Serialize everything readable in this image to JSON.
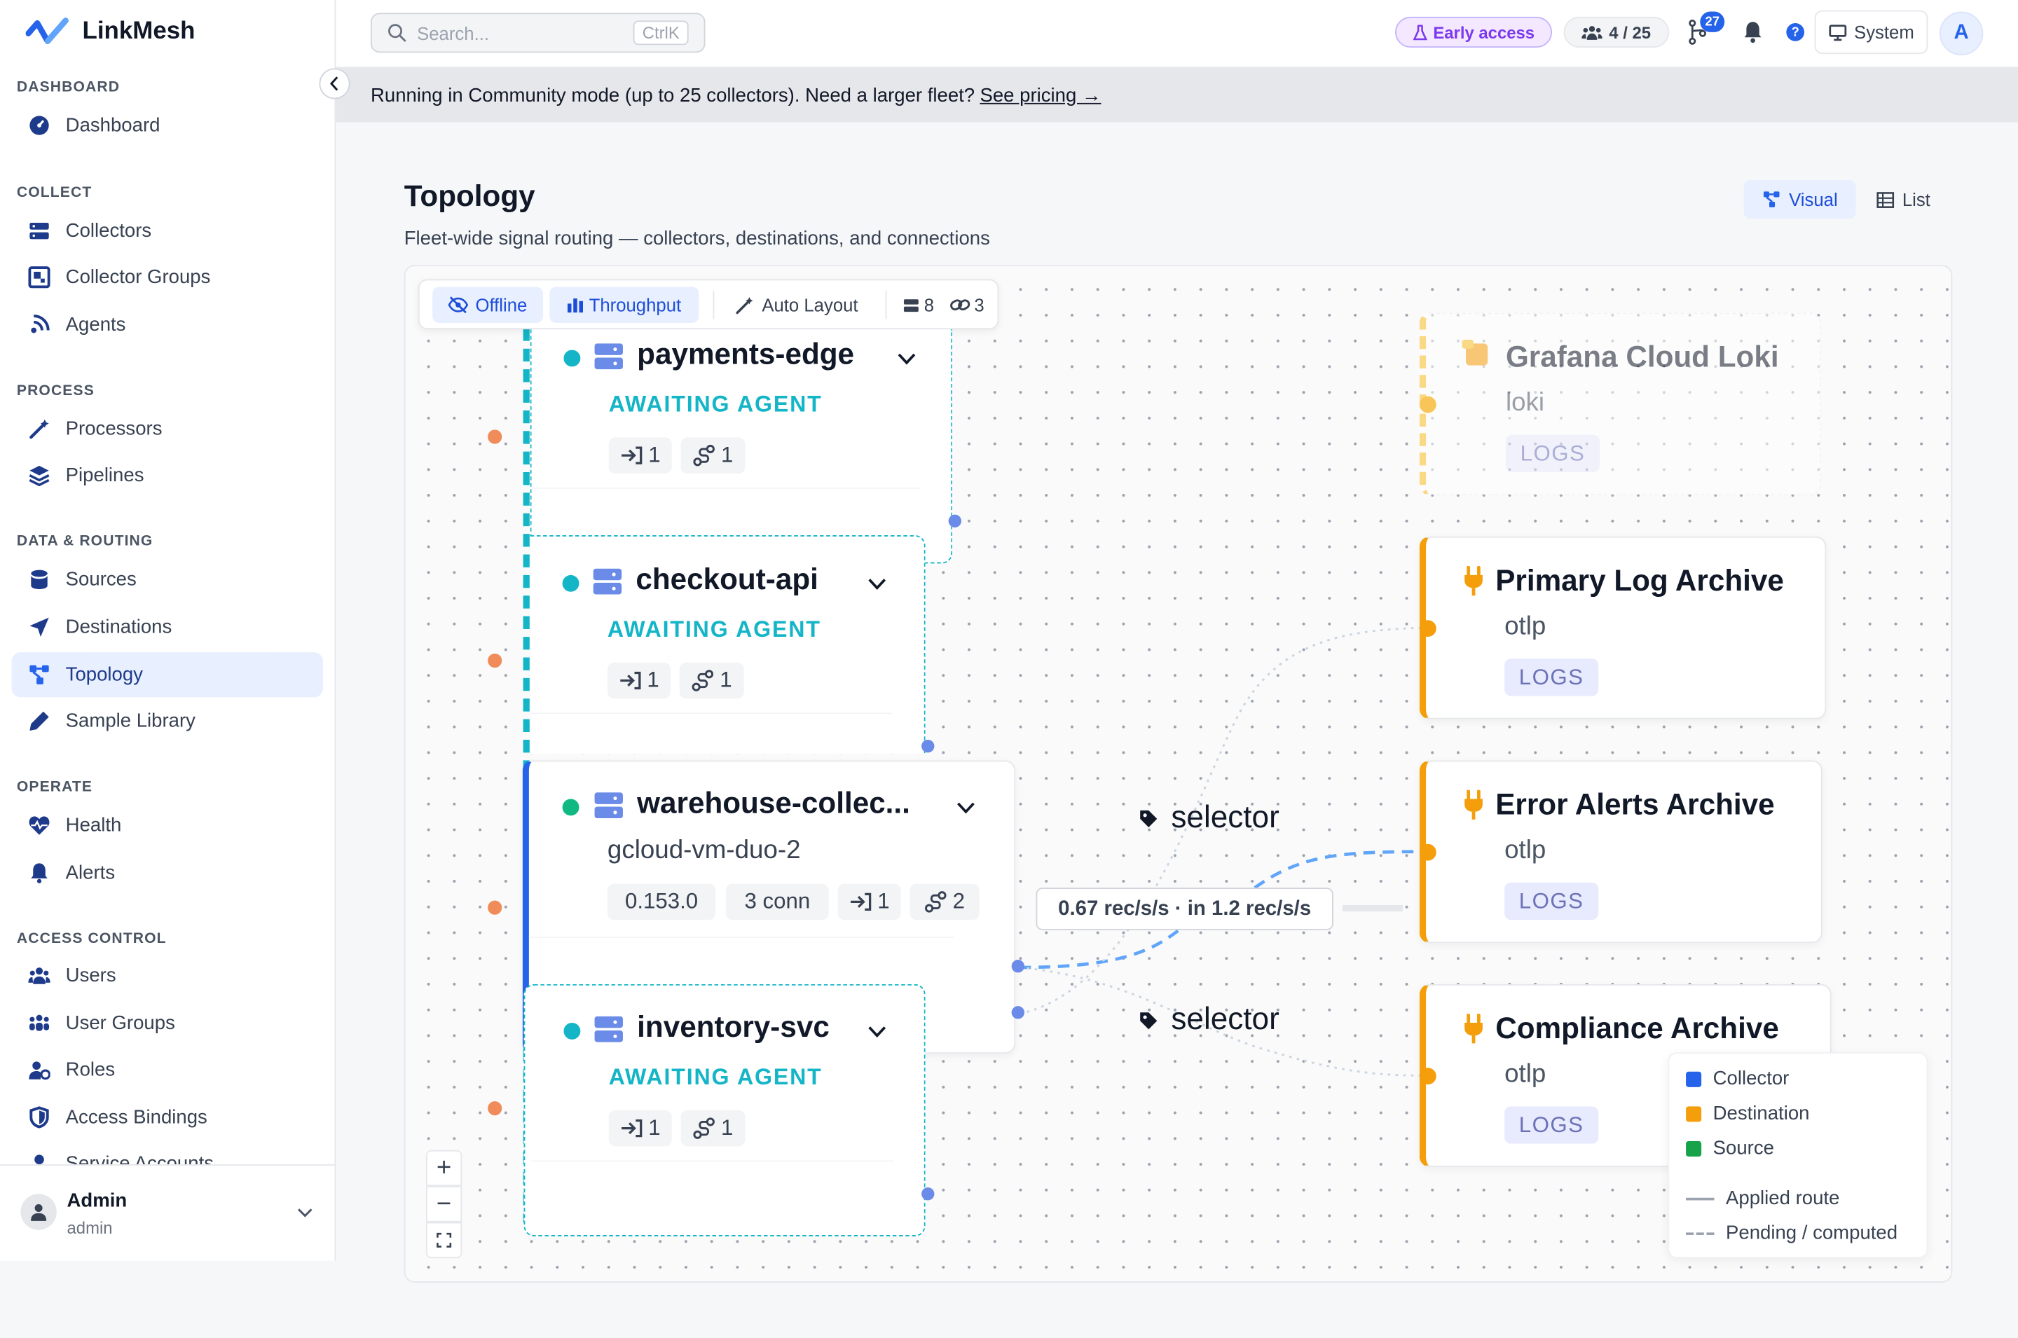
{
  "app": {
    "name": "LinkMesh"
  },
  "sidebar": {
    "sections": [
      {
        "title": "DASHBOARD",
        "items": [
          {
            "label": "Dashboard",
            "icon": "dashboard-icon"
          }
        ]
      },
      {
        "title": "COLLECT",
        "items": [
          {
            "label": "Collectors",
            "icon": "server-icon"
          },
          {
            "label": "Collector Groups",
            "icon": "group-icon"
          },
          {
            "label": "Agents",
            "icon": "signal-icon"
          }
        ]
      },
      {
        "title": "PROCESS",
        "items": [
          {
            "label": "Processors",
            "icon": "wand-icon"
          },
          {
            "label": "Pipelines",
            "icon": "layers-icon"
          }
        ]
      },
      {
        "title": "DATA & ROUTING",
        "items": [
          {
            "label": "Sources",
            "icon": "database-icon"
          },
          {
            "label": "Destinations",
            "icon": "send-icon"
          },
          {
            "label": "Topology",
            "icon": "topology-icon",
            "active": true
          },
          {
            "label": "Sample Library",
            "icon": "pen-icon"
          }
        ]
      },
      {
        "title": "OPERATE",
        "items": [
          {
            "label": "Health",
            "icon": "heartbeat-icon"
          },
          {
            "label": "Alerts",
            "icon": "bell-icon"
          }
        ]
      },
      {
        "title": "ACCESS CONTROL",
        "items": [
          {
            "label": "Users",
            "icon": "users-icon"
          },
          {
            "label": "User Groups",
            "icon": "user-groups-icon"
          },
          {
            "label": "Roles",
            "icon": "role-icon"
          },
          {
            "label": "Access Bindings",
            "icon": "shield-icon"
          },
          {
            "label": "Service Accounts",
            "icon": "key-icon"
          }
        ]
      }
    ],
    "user": {
      "name": "Admin",
      "role": "admin"
    }
  },
  "header": {
    "search_placeholder": "Search...",
    "search_shortcut": "CtrlK",
    "early_access": "Early access",
    "collector_count": "4 / 25",
    "pr_badge": "27",
    "theme": "System",
    "avatar": "A"
  },
  "banner": {
    "text": "Running in Community mode (up to 25 collectors). Need a larger fleet?",
    "link": "See pricing →"
  },
  "page": {
    "title": "Topology",
    "subtitle": "Fleet-wide signal routing — collectors, destinations, and connections",
    "view_visual": "Visual",
    "view_list": "List"
  },
  "toolbar": {
    "offline": "Offline",
    "throughput": "Throughput",
    "auto_layout": "Auto Layout",
    "node_count": "8",
    "link_count": "3"
  },
  "collectors": [
    {
      "name": "payments-edge",
      "status": "AWAITING AGENT",
      "inputs": "1",
      "routes": "1",
      "status_color": "#13b5c7"
    },
    {
      "name": "checkout-api",
      "status": "AWAITING AGENT",
      "inputs": "1",
      "routes": "1",
      "status_color": "#13b5c7"
    },
    {
      "name": "warehouse-collec...",
      "host": "gcloud-vm-duo-2",
      "version": "0.153.0",
      "conns": "3 conn",
      "inputs": "1",
      "routes": "2",
      "status_color": "#10b981"
    },
    {
      "name": "inventory-svc",
      "status": "AWAITING AGENT",
      "inputs": "1",
      "routes": "1",
      "status_color": "#13b5c7"
    }
  ],
  "destinations": [
    {
      "name": "Grafana Cloud Loki",
      "type": "loki",
      "signal": "LOGS"
    },
    {
      "name": "Primary Log Archive",
      "type": "otlp",
      "signal": "LOGS"
    },
    {
      "name": "Error Alerts Archive",
      "type": "otlp",
      "signal": "LOGS"
    },
    {
      "name": "Compliance Archive",
      "type": "otlp",
      "signal": "LOGS"
    }
  ],
  "edges": {
    "selector_1": "selector",
    "selector_2": "selector",
    "throughput_label": "0.67 rec/s/s · in 1.2 rec/s/s"
  },
  "legend": {
    "collector": "Collector",
    "destination": "Destination",
    "source": "Source",
    "applied": "Applied route",
    "pending": "Pending / computed"
  },
  "colors": {
    "accent": "#2563eb",
    "collector": "#2563eb",
    "destination": "#f59e0b",
    "source": "#16a34a",
    "awaiting": "#13b5c7",
    "early_access": "#7c3aed"
  }
}
